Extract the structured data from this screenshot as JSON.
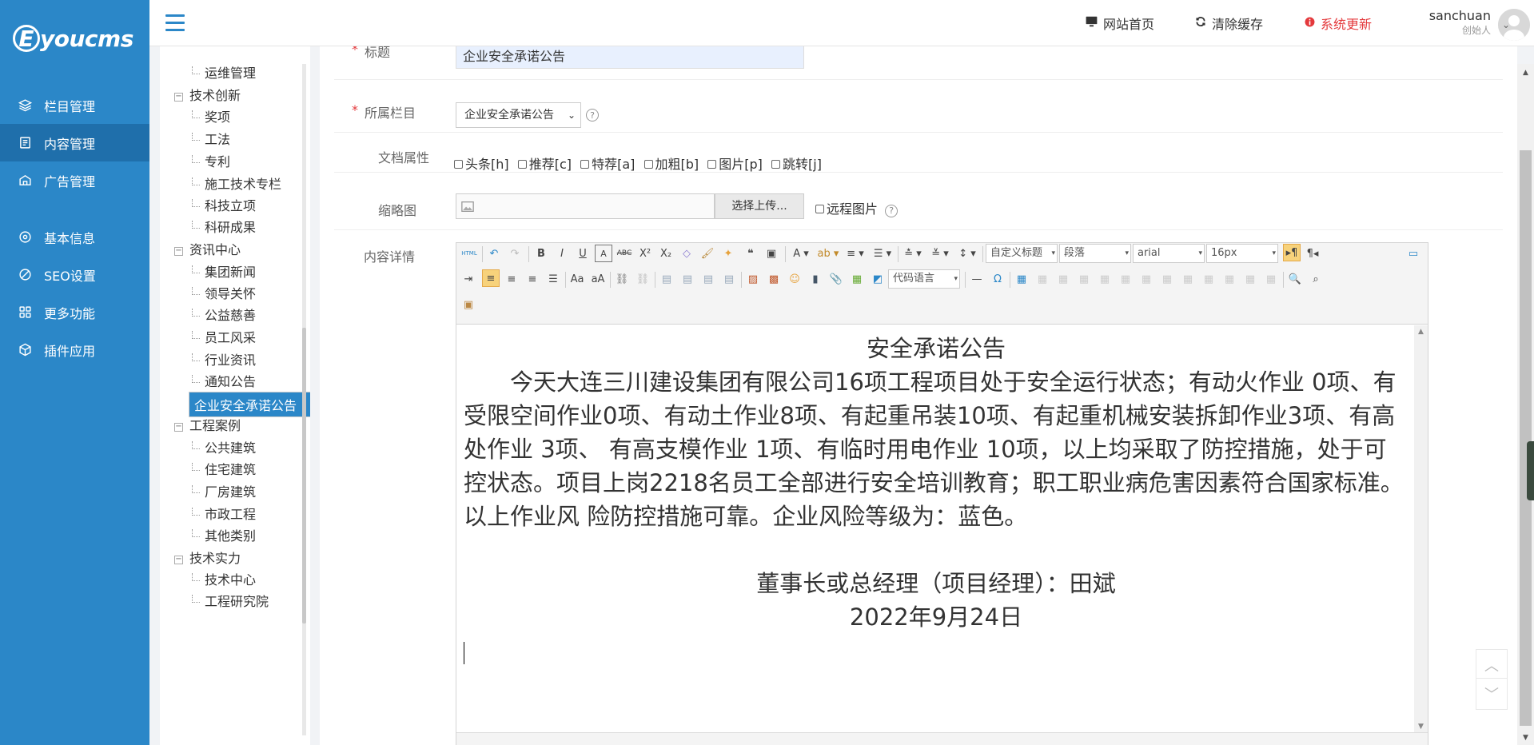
{
  "brand": {
    "logo_letter": "E",
    "logo_text": "youcms"
  },
  "nav": [
    {
      "label": "栏目管理",
      "icon": "layers-icon"
    },
    {
      "label": "内容管理",
      "icon": "document-icon"
    },
    {
      "label": "广告管理",
      "icon": "ad-icon"
    },
    {
      "label": "基本信息",
      "icon": "gear-icon"
    },
    {
      "label": "SEO设置",
      "icon": "seo-icon"
    },
    {
      "label": "更多功能",
      "icon": "grid-icon"
    },
    {
      "label": "插件应用",
      "icon": "plugin-icon"
    }
  ],
  "topbar": {
    "home": "网站首页",
    "clear_cache": "清除缓存",
    "update": "系统更新",
    "user_name": "sanchuan",
    "user_role": "创始人"
  },
  "tree": {
    "items": [
      "运维管理",
      "技术创新",
      "奖项",
      "工法",
      "专利",
      "施工技术专栏",
      "科技立项",
      "科研成果",
      "资讯中心",
      "集团新闻",
      "领导关怀",
      "公益慈善",
      "员工风采",
      "行业资讯",
      "通知公告",
      "企业安全承诺公告",
      "工程案例",
      "公共建筑",
      "住宅建筑",
      "厂房建筑",
      "市政工程",
      "其他类别",
      "技术实力",
      "技术中心",
      "工程研究院"
    ],
    "box_minus": "−"
  },
  "form": {
    "title_label": "标题",
    "title_value": "企业安全承诺公告",
    "column_label": "所属栏目",
    "column_value": "企业安全承诺公告",
    "attr_label": "文档属性",
    "attrs": [
      "头条[h]",
      "推荐[c]",
      "特荐[a]",
      "加粗[b]",
      "图片[p]",
      "跳转[j]"
    ],
    "thumb_label": "缩略图",
    "upload_btn": "选择上传...",
    "remote_label": "远程图片",
    "content_label": "内容详情",
    "help_mark": "?"
  },
  "editor": {
    "select_heading": "自定义标题",
    "select_paragraph": "段落",
    "select_font": "arial",
    "select_size": "16px",
    "select_code": "代码语言",
    "html_btn": "HTML"
  },
  "content": {
    "title": "安全承诺公告",
    "body": "今天大连三川建设集团有限公司16项工程项目处于安全运行状态；有动火作业 0项、有受限空间作业0项、有动土作业8项、有起重吊装10项、有起重机械安装拆卸作业3项、有高处作业 3项、 有高支模作业 1项、有临时用电作业 10项，以上均采取了防控措施，处于可控状态。项目上岗2218名员工全部进行安全培训教育；职工职业病危害因素符合国家标准。以上作业风 险防控措施可靠。企业风险等级为：蓝色。",
    "signature": "董事长或总经理（项目经理）：田斌",
    "date": "2022年9月24日"
  },
  "colors": {
    "accent": "#2b87c8",
    "alert": "#e4393c"
  }
}
